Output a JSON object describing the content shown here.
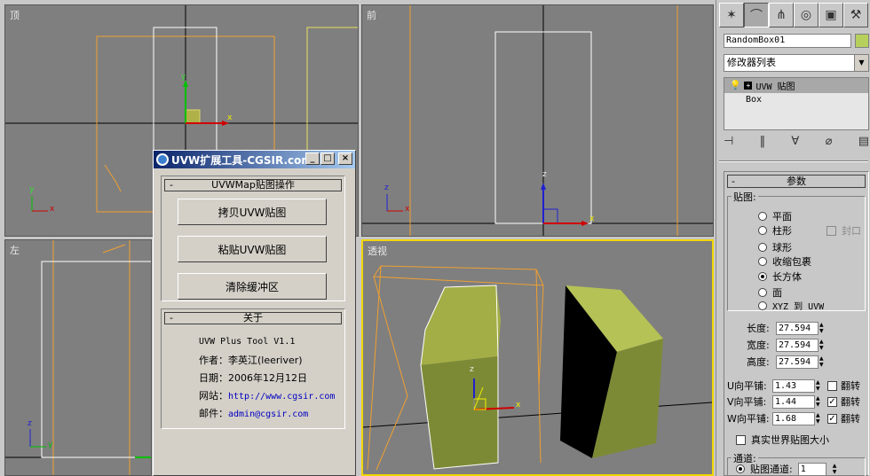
{
  "viewports": {
    "top": {
      "label": "顶"
    },
    "front": {
      "label": "前"
    },
    "left": {
      "label": "左"
    },
    "perspective": {
      "label": "透视"
    },
    "axis_x": "x",
    "axis_y": "y",
    "axis_z": "z"
  },
  "dialog": {
    "title": "UVW扩展工具-CGSIR.com",
    "uvw_rollout": {
      "minus": "-",
      "title": "UVWMap贴图操作",
      "buttons": [
        "拷贝UVW贴图",
        "粘贴UVW贴图",
        "清除缓冲区"
      ]
    },
    "about_rollout": {
      "minus": "-",
      "title": "关于",
      "name": "UVW Plus Tool V1.1",
      "author_label": "作者：",
      "author_value": "李英江(leeriver)",
      "date_label": "日期：",
      "date_value": "2006年12月12日",
      "website_label": "网站：",
      "website_value": "http://www.cgsir.com",
      "email_label": "邮件：",
      "email_value": "admin@cgsir.com"
    }
  },
  "command_panel": {
    "object_name": "RandomBox01",
    "object_color": "#b7d05b",
    "modifier_list": "修改器列表",
    "stack": {
      "modifier": "UVW 贴图",
      "base": "Box"
    },
    "params": {
      "minus": "-",
      "title": "参数",
      "mapping_label": "贴图:",
      "options": [
        "平面",
        "柱形",
        "球形",
        "收缩包裹",
        "长方体",
        "面",
        "XYZ 到 UVW"
      ],
      "selected_option": "长方体",
      "cap_label": "封口",
      "length_label": "长度:",
      "length": "27.594",
      "width_label": "宽度:",
      "width": "27.594",
      "height_label": "高度:",
      "height": "27.594",
      "u_tile_label": "U向平铺:",
      "u_tile": "1.43",
      "v_tile_label": "V向平铺:",
      "v_tile": "1.44",
      "w_tile_label": "W向平铺:",
      "w_tile": "1.68",
      "flip_label": "翻转",
      "u_flip": false,
      "v_flip": true,
      "w_flip": true,
      "real_world_label": "真实世界贴图大小",
      "channel_group": "通道:",
      "channel_label": "贴图通道:",
      "channel_value": "1"
    }
  }
}
